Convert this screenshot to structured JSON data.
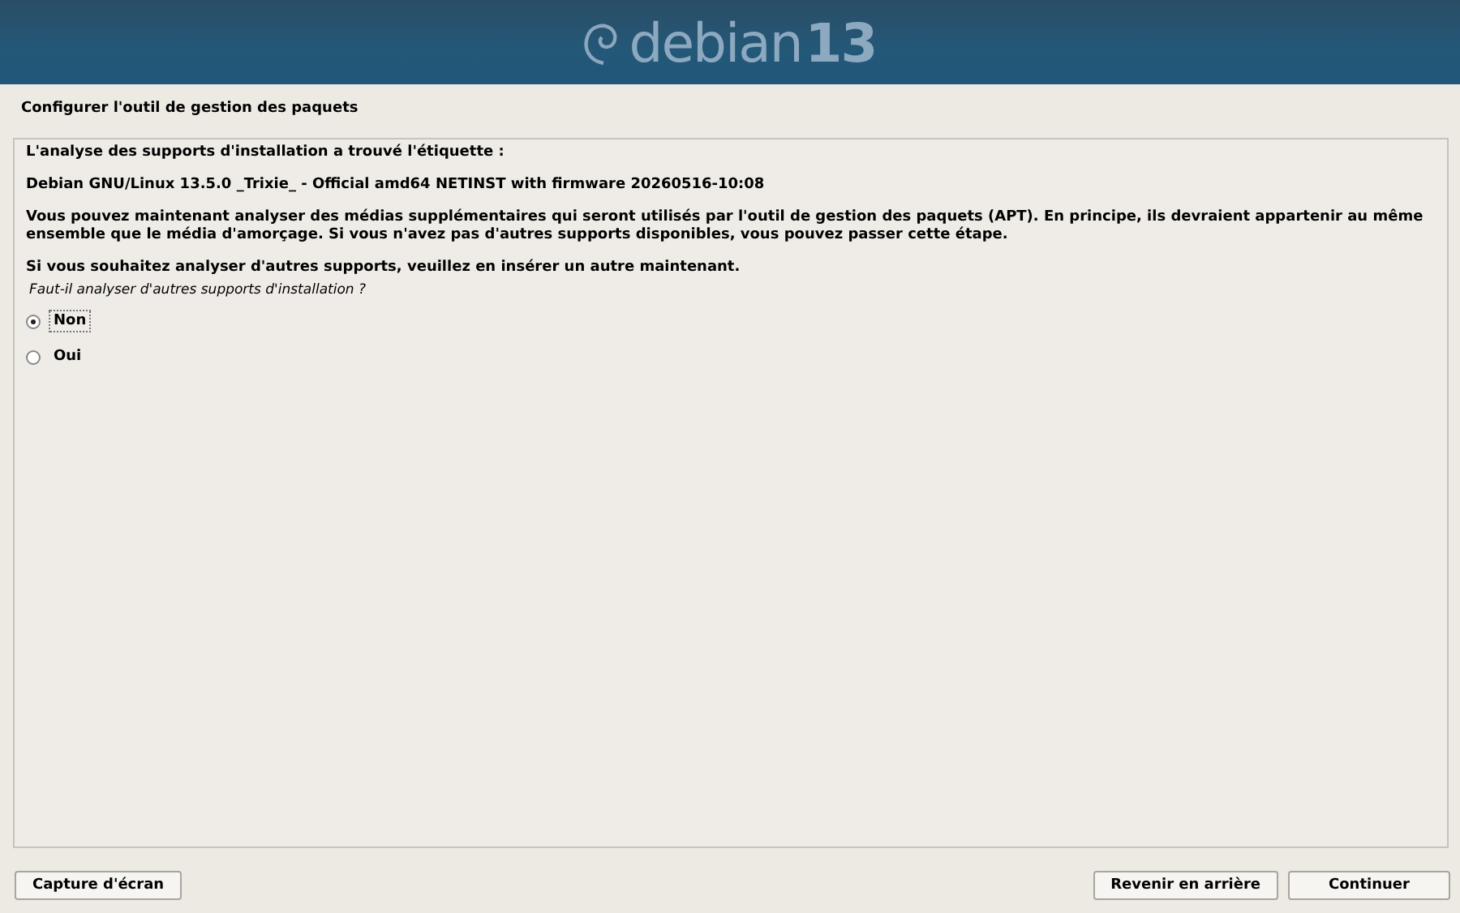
{
  "banner": {
    "logo_text": "debian",
    "version": "13"
  },
  "title": "Configurer l'outil de gestion des paquets",
  "content": {
    "paragraphs": [
      {
        "text": "L'analyse des supports d'installation a trouvé l'étiquette :"
      },
      {
        "text": "Debian GNU/Linux 13.5.0 _Trixie_ - Official amd64 NETINST with firmware 20260516-10:08"
      },
      {
        "text": "Vous pouvez maintenant analyser des médias supplémentaires qui seront utilisés par l'outil de gestion des paquets (APT). En principe, ils devraient appartenir au même ensemble que le média d'amorçage. Si vous n'avez pas d'autres supports disponibles, vous pouvez passer cette étape."
      },
      {
        "text": "Si vous souhaitez analyser d'autres supports, veuillez en insérer un autre maintenant."
      }
    ],
    "question": "Faut-il analyser d'autres supports d'installation ?",
    "options": [
      {
        "label": "Non",
        "selected": true
      },
      {
        "label": "Oui",
        "selected": false
      }
    ]
  },
  "buttons": {
    "left": [
      {
        "label": "Capture d'écran"
      }
    ],
    "right": [
      {
        "label": "Revenir en arrière"
      },
      {
        "label": "Continuer"
      }
    ]
  }
}
